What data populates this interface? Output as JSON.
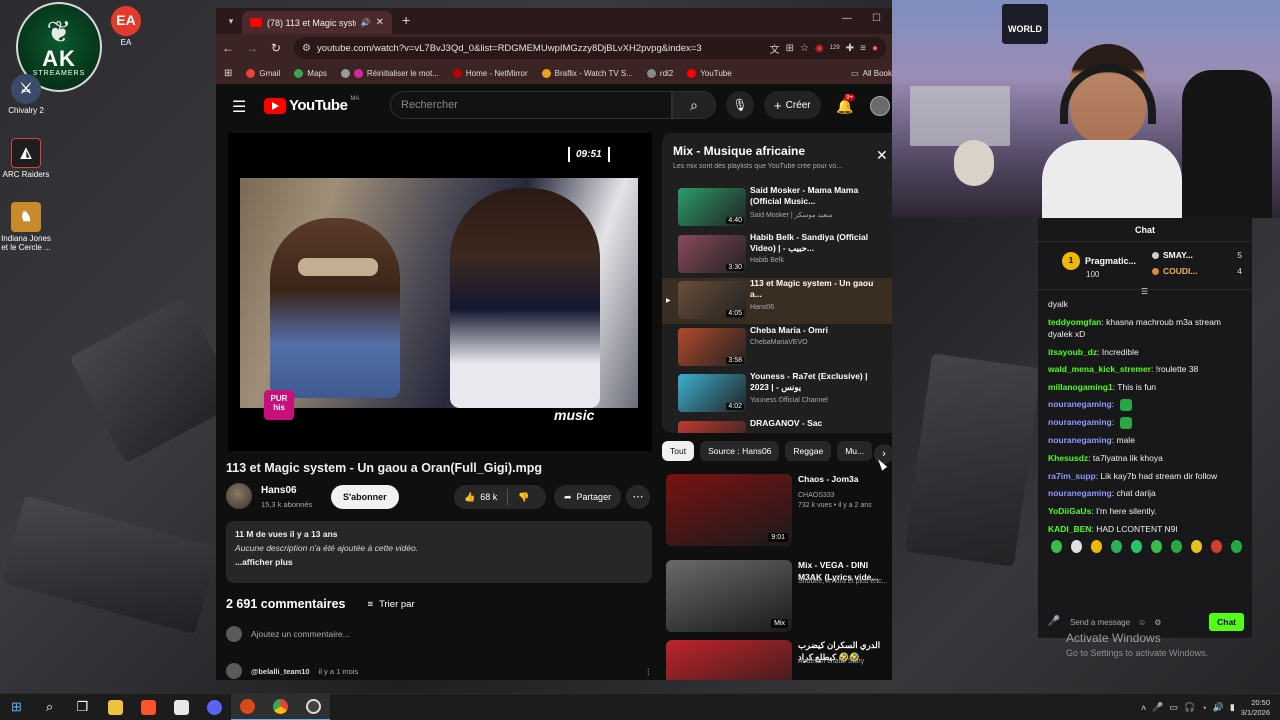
{
  "desktop": {
    "logo": {
      "main": "AK",
      "sub": "STREAMERS"
    },
    "icons": [
      {
        "label": "EA"
      },
      {
        "label": "Chivalry 2"
      },
      {
        "label": "ARC Raiders"
      },
      {
        "label": "Indiana Jones et le Cercle ..."
      }
    ]
  },
  "browser": {
    "tab_title": "(78) 113 et Magic system -",
    "url": "youtube.com/watch?v=vL7BvJ3Qd_0&list=RDGMEMUwpIMGzzy8DjBLvXH2pvpg&index=3",
    "ext_badge": "129",
    "bookmarks": [
      "Gmail",
      "Maps",
      "Réinitialiser le mot...",
      "Home - NetMirror",
      "Braflix - Watch TV S...",
      "rdi2",
      "YouTube",
      "All Book"
    ]
  },
  "youtube": {
    "logo_text": "YouTube",
    "country": "MA",
    "search_placeholder": "Rechercher",
    "create_label": "Créer",
    "notif_count": "9+",
    "player": {
      "timestamp": "09:51",
      "pur_logo": "PUR his",
      "music_logo": "music"
    },
    "video": {
      "title": "113 et Magic system - Un gaou a Oran(Full_Gigi).mpg",
      "channel": "Hans06",
      "subscribers": "15,3 k abonnés",
      "subscribe_label": "S'abonner",
      "likes": "68 k",
      "share_label": "Partager",
      "views_line": "11 M de vues  il y a 13 ans",
      "description": "Aucune description n'a été ajoutée à cette vidéo.",
      "show_more": "...afficher plus"
    },
    "comments": {
      "count_label": "2 691 commentaires",
      "sort_label": "Trier par",
      "add_placeholder": "Ajoutez un commentaire...",
      "first": {
        "author": "@belalli_team10",
        "when": "il y a 1 mois"
      }
    },
    "playlist": {
      "title": "Mix - Musique africaine",
      "subtitle": "Les mix sont des playlists que YouTube crée pour vo...",
      "items": [
        {
          "title": "Said Mosker - Mama Mama (Official Music...",
          "channel": "Said Mosker | سعيد موسكر",
          "duration": "4:40",
          "color": "#2a9d6a"
        },
        {
          "title": "Habib Belk - Sandiya (Official Video) | - حبيب...",
          "channel": "Habib Belk",
          "duration": "3:30",
          "color": "#8a4a5a"
        },
        {
          "title": "113 et Magic system - Un gaou a...",
          "channel": "Hans06",
          "duration": "4:05",
          "color": "#6a4e3a"
        },
        {
          "title": "Cheba Maria - Omri",
          "channel": "ChebaMariaVEVO",
          "duration": "3:58",
          "color": "#b04a2a"
        },
        {
          "title": "Youness - Ra7et (Exclusive) | 2023 | - يونس",
          "channel": "Youness Official Channel",
          "duration": "4:02",
          "color": "#3ab0d0"
        },
        {
          "title": "DRAGANOV - Sac",
          "channel": "",
          "duration": "",
          "color": "#c03a30"
        }
      ]
    },
    "chips": [
      "Tout",
      "Source : Hans06",
      "Reggae",
      "Mu..."
    ],
    "recommendations": [
      {
        "title": "Chaos - Jom3a",
        "channel": "CHAOS333",
        "meta": "732 k vues • il y a 2 ans",
        "duration": "9:01",
        "color": "#7a1212"
      },
      {
        "title": "Mix - VEGA - DINI M3AK (Lyrics vide...",
        "channel": "Shobee, X7kira et plus enc...",
        "meta": "",
        "duration": "Mix",
        "color": "#6a6a6a"
      },
      {
        "title": "الدري السكران كيضرب كيطلع كراد 🤣🤣",
        "channel": "Abdellah chafai Story",
        "meta": "",
        "duration": "",
        "color": "#c0242a"
      }
    ]
  },
  "chat": {
    "header": "Chat",
    "leaderboard": [
      {
        "rank": "1",
        "name": "Pragmatic...",
        "points": "100"
      },
      {
        "name": "SMAY...",
        "points": "5",
        "color": "#cfcfcf"
      },
      {
        "name": "COUDI...",
        "points": "4",
        "color": "#d98b3a"
      }
    ],
    "messages": [
      {
        "user": "",
        "text": "dyalk"
      },
      {
        "user": "teddyomgfan",
        "text": "khasna machroub m3a stream dyalek xD"
      },
      {
        "user": "itsayoub_dz",
        "text": "Incredible"
      },
      {
        "user": "wald_mena_kick_stremer",
        "text": "!roulette 38"
      },
      {
        "user": "millanogaming1",
        "text": "This is fun"
      },
      {
        "user": "nouranegaming",
        "text": ""
      },
      {
        "user": "nouranegaming",
        "text": ""
      },
      {
        "user": "nouranegaming",
        "text": "male"
      },
      {
        "user": "Khesusdz",
        "text": "ta7lyatna lik khoya"
      },
      {
        "user": "ra7im_supp",
        "text": "Lik kay7b had stream dir follow"
      },
      {
        "user": "nouranegaming",
        "text": "chat darija"
      },
      {
        "user": "YoDiiGaUs",
        "text": "I'm here silently."
      },
      {
        "user": "KADI_BEN",
        "text": "HAD LCONTENT N9I"
      }
    ],
    "input_placeholder": "Send a message",
    "chat_button": "Chat"
  },
  "os": {
    "activate_title": "Activate Windows",
    "activate_sub": "Go to Settings to activate Windows.",
    "time": "20:50",
    "date": "3/1/2026"
  }
}
